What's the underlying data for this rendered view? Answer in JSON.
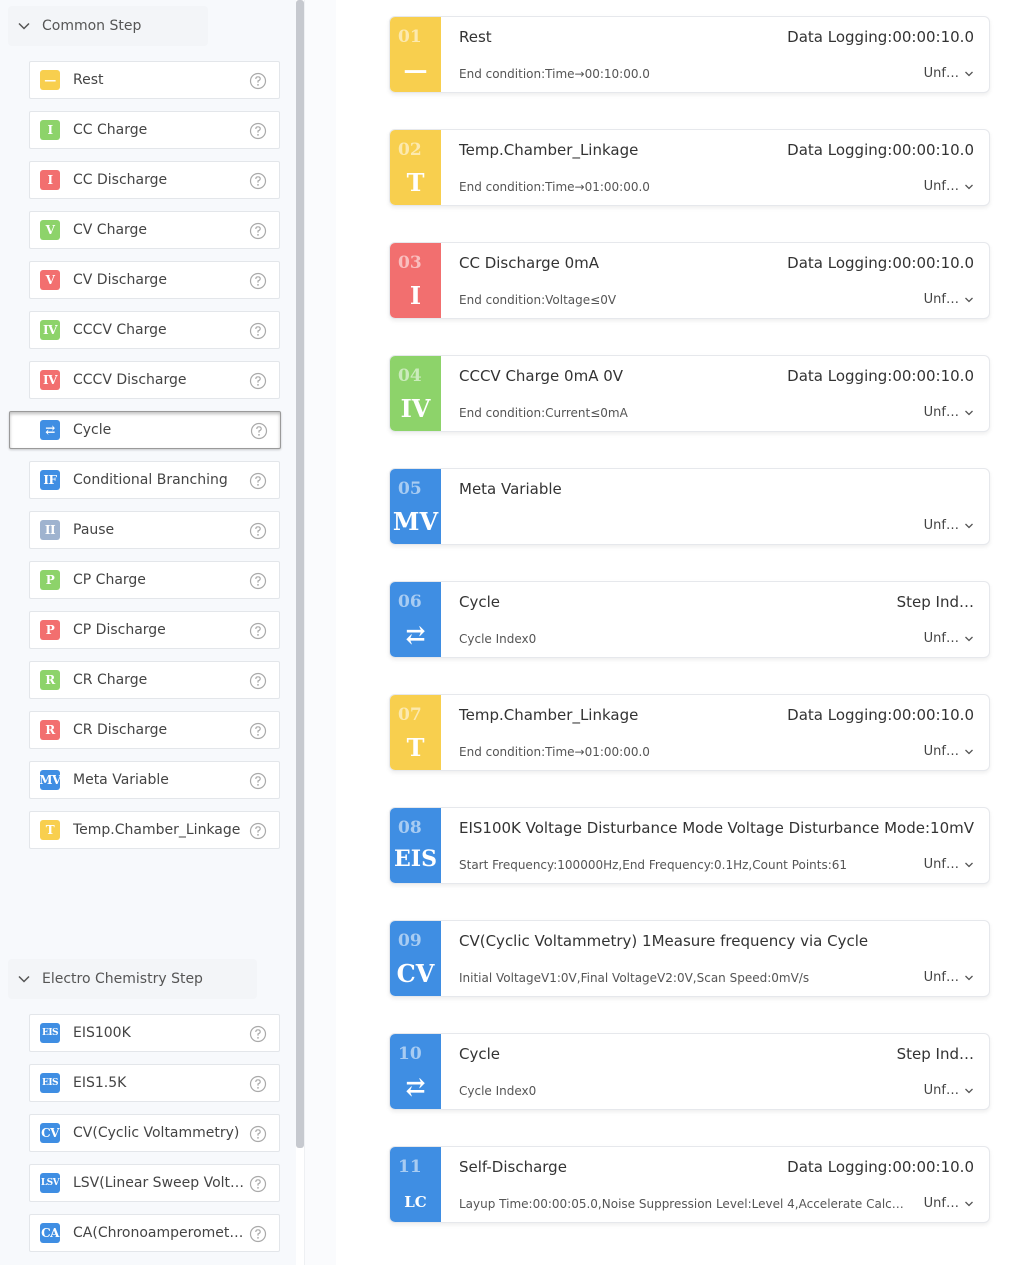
{
  "colors": {
    "yellow": "#f8cf4e",
    "green": "#8dd36a",
    "red": "#f26f6f",
    "blue": "#3f8ee3",
    "pause_gray": "#9fb3cf"
  },
  "palette": {
    "common_header": "Common Step",
    "electro_header": "Electro Chemistry Step",
    "common_items": [
      {
        "label": "Rest",
        "badge": "—",
        "color": "#f8cf4e",
        "icon": "rest-icon"
      },
      {
        "label": "CC Charge",
        "badge": "I",
        "color": "#8dd36a",
        "icon": "cc-charge-icon"
      },
      {
        "label": "CC Discharge",
        "badge": "I",
        "color": "#f26f6f",
        "icon": "cc-discharge-icon"
      },
      {
        "label": "CV Charge",
        "badge": "V",
        "color": "#8dd36a",
        "icon": "cv-charge-icon"
      },
      {
        "label": "CV Discharge",
        "badge": "V",
        "color": "#f26f6f",
        "icon": "cv-discharge-icon"
      },
      {
        "label": "CCCV Charge",
        "badge": "IV",
        "color": "#8dd36a",
        "icon": "cccv-charge-icon"
      },
      {
        "label": "CCCV Discharge",
        "badge": "IV",
        "color": "#f26f6f",
        "icon": "cccv-discharge-icon"
      },
      {
        "label": "Cycle",
        "badge": "⇄",
        "color": "#3f8ee3",
        "icon": "cycle-icon",
        "selected": true
      },
      {
        "label": "Conditional Branching",
        "badge": "IF",
        "color": "#3f8ee3",
        "icon": "if-icon"
      },
      {
        "label": "Pause",
        "badge": "II",
        "color": "#9fb3cf",
        "icon": "pause-icon"
      },
      {
        "label": "CP Charge",
        "badge": "P",
        "color": "#8dd36a",
        "icon": "cp-charge-icon"
      },
      {
        "label": "CP Discharge",
        "badge": "P",
        "color": "#f26f6f",
        "icon": "cp-discharge-icon"
      },
      {
        "label": "CR Charge",
        "badge": "R",
        "color": "#8dd36a",
        "icon": "cr-charge-icon"
      },
      {
        "label": "CR Discharge",
        "badge": "R",
        "color": "#f26f6f",
        "icon": "cr-discharge-icon"
      },
      {
        "label": "Meta Variable",
        "badge": "MV",
        "color": "#3f8ee3",
        "icon": "meta-variable-icon"
      },
      {
        "label": "Temp.Chamber_Linkage",
        "badge": "T",
        "color": "#f8cf4e",
        "icon": "temp-chamber-icon"
      }
    ],
    "electro_items": [
      {
        "label": "EIS100K",
        "badge": "EIS",
        "color": "#3f8ee3",
        "icon": "eis-icon"
      },
      {
        "label": "EIS1.5K",
        "badge": "EIS",
        "color": "#3f8ee3",
        "icon": "eis-icon"
      },
      {
        "label": "CV(Cyclic Voltammetry)",
        "badge": "CV",
        "color": "#3f8ee3",
        "icon": "cv-icon"
      },
      {
        "label": "LSV(Linear Sweep Volta…",
        "badge": "LSV",
        "color": "#3f8ee3",
        "icon": "lsv-icon"
      },
      {
        "label": "CA(Chronoamperometry)",
        "badge": "CA",
        "color": "#3f8ee3",
        "icon": "ca-icon"
      }
    ]
  },
  "steps": [
    {
      "num": "01",
      "icon": "—",
      "icon_name": "rest-icon",
      "color": "#f8cf4e",
      "title": "Rest",
      "right": "Data Logging:00:00:10.0",
      "sub": "End condition:Time→00:10:00.0",
      "status": "Unf…"
    },
    {
      "num": "02",
      "icon": "T",
      "icon_name": "temp-chamber-icon",
      "color": "#f8cf4e",
      "title": "Temp.Chamber_Linkage",
      "right": "Data Logging:00:00:10.0",
      "sub": "End condition:Time→01:00:00.0",
      "status": "Unf…"
    },
    {
      "num": "03",
      "icon": "I",
      "icon_name": "cc-discharge-icon",
      "color": "#f26f6f",
      "title": "CC Discharge   0mA",
      "right": "Data Logging:00:00:10.0",
      "sub": "End condition:Voltage≤0V",
      "status": "Unf…"
    },
    {
      "num": "04",
      "icon": "IV",
      "icon_name": "cccv-charge-icon",
      "color": "#8dd36a",
      "title": "CCCV Charge   0mA  0V",
      "right": "Data Logging:00:00:10.0",
      "sub": "End condition:Current≤0mA",
      "status": "Unf…"
    },
    {
      "num": "05",
      "icon": "MV",
      "icon_name": "meta-variable-icon",
      "color": "#3f8ee3",
      "title": "Meta Variable",
      "right": "",
      "sub": "",
      "status": "Unf…"
    },
    {
      "num": "06",
      "icon": "⇄",
      "icon_name": "cycle-icon",
      "color": "#3f8ee3",
      "title": "Cycle",
      "right": "Step Ind…",
      "sub": "Cycle Index0",
      "status": "Unf…"
    },
    {
      "num": "07",
      "icon": "T",
      "icon_name": "temp-chamber-icon",
      "color": "#f8cf4e",
      "title": "Temp.Chamber_Linkage",
      "right": "Data Logging:00:00:10.0",
      "sub": "End condition:Time→01:00:00.0",
      "status": "Unf…"
    },
    {
      "num": "08",
      "icon": "EIS",
      "icon_name": "eis-icon",
      "color": "#3f8ee3",
      "title": "EIS100K   Voltage Disturbance Mode",
      "right": "Voltage Disturbance Mode:10mV",
      "sub": "Start Frequency:100000Hz,End Frequency:0.1Hz,Count Points:61",
      "status": "Unf…"
    },
    {
      "num": "09",
      "icon": "CV",
      "icon_name": "cv-icon",
      "color": "#3f8ee3",
      "title": "CV(Cyclic Voltammetry)   1Measure frequency via Cycle",
      "right": "",
      "sub": "Initial VoltageV1:0V,Final VoltageV2:0V,Scan Speed:0mV/s",
      "status": "Unf…"
    },
    {
      "num": "10",
      "icon": "⇄",
      "icon_name": "cycle-icon",
      "color": "#3f8ee3",
      "title": "Cycle",
      "right": "Step Ind…",
      "sub": "Cycle Index0",
      "status": "Unf…"
    },
    {
      "num": "11",
      "icon": "LC",
      "icon_name": "self-discharge-icon",
      "color": "#3f8ee3",
      "title": "Self-Discharge",
      "right": "Data Logging:00:00:10.0",
      "sub": "Layup Time:00:00:05.0,Noise Suppression Level:Level 4,Accelerate Calc…",
      "status": "Unf…"
    }
  ]
}
